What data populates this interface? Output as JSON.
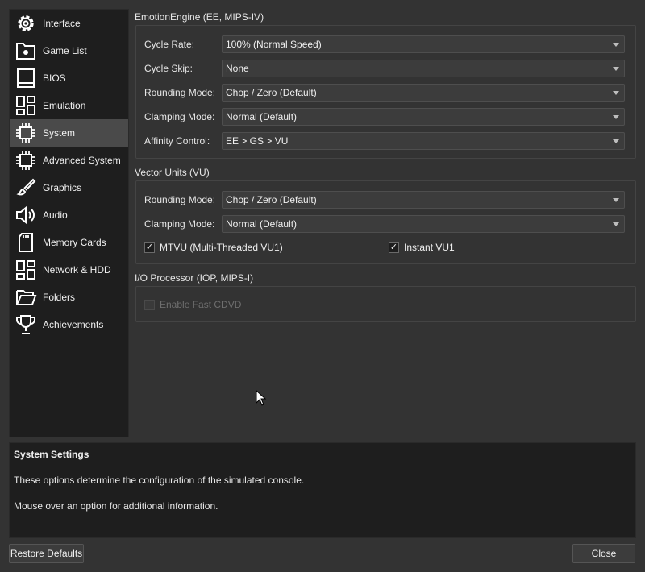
{
  "sidebar": {
    "items": [
      {
        "label": "Interface",
        "icon": "gear-icon"
      },
      {
        "label": "Game List",
        "icon": "folder-settings-icon"
      },
      {
        "label": "BIOS",
        "icon": "monitor-icon"
      },
      {
        "label": "Emulation",
        "icon": "dashboard-icon"
      },
      {
        "label": "System",
        "icon": "chip-icon",
        "selected": true
      },
      {
        "label": "Advanced System",
        "icon": "chip-icon"
      },
      {
        "label": "Graphics",
        "icon": "brush-icon"
      },
      {
        "label": "Audio",
        "icon": "speaker-icon"
      },
      {
        "label": "Memory Cards",
        "icon": "sd-card-icon"
      },
      {
        "label": "Network & HDD",
        "icon": "dashboard-icon"
      },
      {
        "label": "Folders",
        "icon": "folder-open-icon"
      },
      {
        "label": "Achievements",
        "icon": "trophy-icon"
      }
    ]
  },
  "ee": {
    "title": "EmotionEngine (EE, MIPS-IV)",
    "rows": [
      {
        "label": "Cycle Rate:",
        "value": "100% (Normal Speed)"
      },
      {
        "label": "Cycle Skip:",
        "value": "None"
      },
      {
        "label": "Rounding Mode:",
        "value": "Chop / Zero (Default)"
      },
      {
        "label": "Clamping Mode:",
        "value": "Normal (Default)"
      },
      {
        "label": "Affinity Control:",
        "value": "EE > GS > VU"
      }
    ]
  },
  "vu": {
    "title": "Vector Units (VU)",
    "rows": [
      {
        "label": "Rounding Mode:",
        "value": "Chop / Zero (Default)"
      },
      {
        "label": "Clamping Mode:",
        "value": "Normal (Default)"
      }
    ],
    "mtvu_label": "MTVU (Multi-Threaded VU1)",
    "mtvu_checked": true,
    "instant_label": "Instant VU1",
    "instant_checked": true
  },
  "iop": {
    "title": "I/O Processor (IOP, MIPS-I)",
    "fast_cdvd_label": "Enable Fast CDVD",
    "fast_cdvd_checked": false
  },
  "info": {
    "title": "System Settings",
    "line1": "These options determine the configuration of the simulated console.",
    "line2": "Mouse over an option for additional information."
  },
  "buttons": {
    "restore": "Restore Defaults",
    "close": "Close"
  },
  "check_mark": "✓"
}
